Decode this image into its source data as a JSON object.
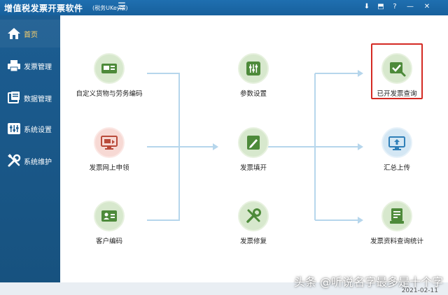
{
  "window": {
    "title": "增值税发票开票软件",
    "edition": "(税务UKey版)",
    "controls": [
      "⬇",
      "⬒",
      "?",
      "—",
      "✕"
    ]
  },
  "sidebar": {
    "items": [
      {
        "label": "首页",
        "icon": "home-icon",
        "active": true
      },
      {
        "label": "发票管理",
        "icon": "printer-icon"
      },
      {
        "label": "数据管理",
        "icon": "data-icon"
      },
      {
        "label": "系统设置",
        "icon": "sliders-icon"
      },
      {
        "label": "系统维护",
        "icon": "tools-icon"
      }
    ]
  },
  "flow": {
    "nodes": [
      {
        "label": "自定义货物与劳务编码",
        "icon": "goods-code-icon"
      },
      {
        "label": "发票网上申领",
        "icon": "online-apply-icon"
      },
      {
        "label": "客户编码",
        "icon": "customer-card-icon"
      },
      {
        "label": "参数设置",
        "icon": "settings-sliders-icon"
      },
      {
        "label": "发票填开",
        "icon": "invoice-fill-icon"
      },
      {
        "label": "发票修复",
        "icon": "repair-tools-icon"
      },
      {
        "label": "已开发票查询",
        "icon": "issued-query-icon",
        "highlighted": true
      },
      {
        "label": "汇总上传",
        "icon": "summary-upload-icon"
      },
      {
        "label": "发票资料查询统计",
        "icon": "stats-query-icon"
      }
    ]
  },
  "colors": {
    "sidebar": "#1c5d92",
    "titlebar": "#1f6fb0",
    "icon_green": "#4d8a3a",
    "circle_bg": "#d7e8cd",
    "arrow": "#b6d6ec",
    "highlight": "#d42a23"
  },
  "footer": {
    "date": "2021-02-11",
    "watermark": "头条 @听说名字最多是十个字"
  }
}
